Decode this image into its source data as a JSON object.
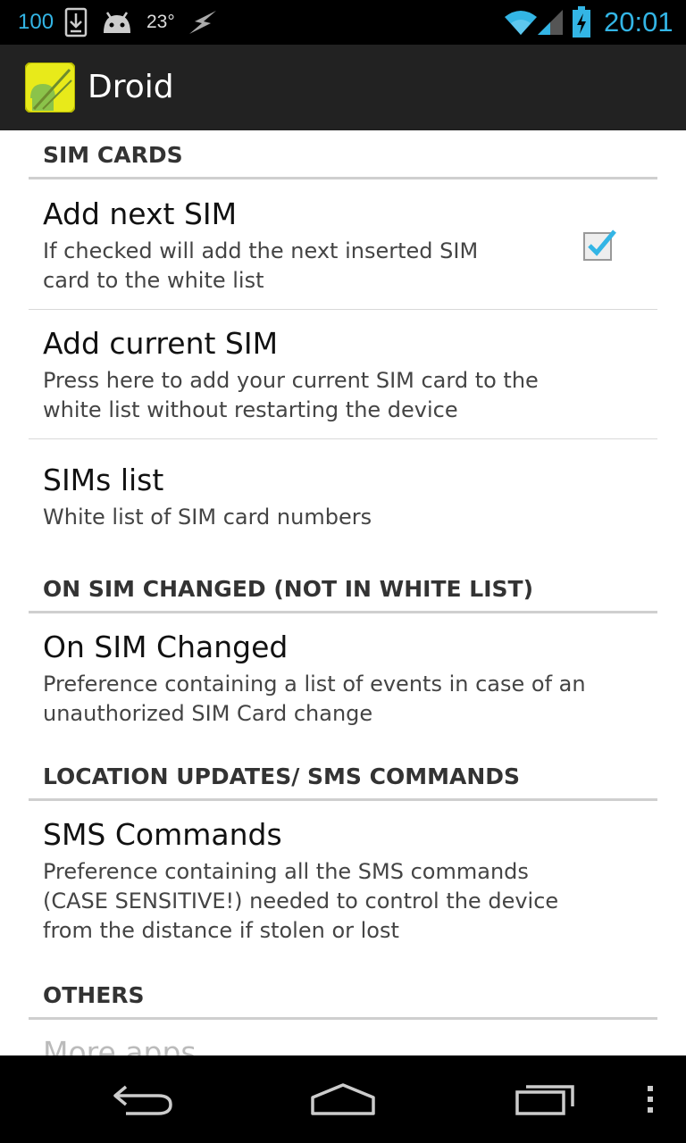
{
  "status_bar": {
    "battery_level": "100",
    "temperature": "23°",
    "clock": "20:01",
    "accent_color": "#33b5e5",
    "icons": [
      "download-icon",
      "android-icon",
      "flash-icon",
      "wifi-icon",
      "signal-icon",
      "battery-charging-icon"
    ]
  },
  "action_bar": {
    "title": "Droid",
    "icon": "app-icon"
  },
  "sections": {
    "sim_cards": {
      "header": "SIM CARDS",
      "add_next_sim": {
        "title": "Add next SIM",
        "summary_line1": "If checked will add the next inserted SIM",
        "summary_line2": "card to the white list",
        "checked": true
      },
      "add_current_sim": {
        "title": "Add current SIM",
        "summary_line1": "Press here to add your current SIM card to the",
        "summary_line2": "white list without restarting the device"
      },
      "sims_list": {
        "title": "SIMs list",
        "summary_line1": "White list of SIM card numbers"
      }
    },
    "on_sim_changed": {
      "header": "ON SIM CHANGED (NOT IN WHITE LIST)",
      "item": {
        "title": "On SIM Changed",
        "summary_line1": "Preference containing a list of events in case of an",
        "summary_line2": "unauthorized SIM Card change"
      }
    },
    "location_updates": {
      "header": "LOCATION UPDATES/ SMS COMMANDS",
      "item": {
        "title": "SMS Commands",
        "summary_line1": "Preference containing all the SMS commands",
        "summary_line2": "(CASE SENSITIVE!) needed to control the device",
        "summary_line3": "from the distance if stolen or lost"
      }
    },
    "others": {
      "header": "OTHERS",
      "more_apps": "More apps"
    }
  },
  "nav_bar": {
    "icons": [
      "back-icon",
      "home-icon",
      "recent-apps-icon",
      "menu-icon"
    ]
  }
}
